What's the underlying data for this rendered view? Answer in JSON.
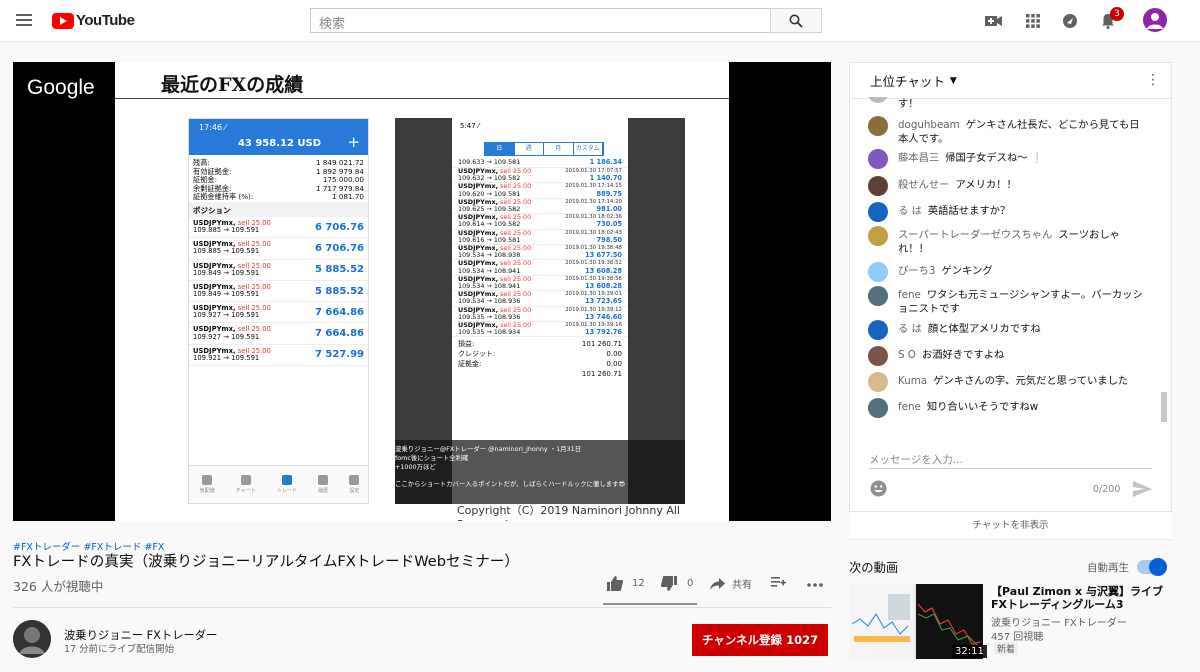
{
  "header": {
    "logo": "YouTube",
    "search_placeholder": "検索",
    "notif_count": "3"
  },
  "video": {
    "google_text": "Google",
    "slide_title": "最近のFXの成績",
    "copyright": "Copyright（C）2019 Naminori Johnny All Reserved",
    "phone1": {
      "time": "17:46 ⁄",
      "balance": "43 958.12 USD",
      "plus": "+",
      "stats": [
        {
          "k": "残高:",
          "v": "1 849 021.72"
        },
        {
          "k": "有効証拠金:",
          "v": "1 892 979.84"
        },
        {
          "k": "証拠金:",
          "v": "175 000.00"
        },
        {
          "k": "余剰証拠金:",
          "v": "1 717 979.84"
        },
        {
          "k": "証拠金維持率 (%):",
          "v": "1 081.70"
        }
      ],
      "positions_title": "ポジション",
      "positions": [
        {
          "sym": "USDJPYmx,",
          "side": "sell 25.00",
          "rate": "109.885 → 109.591",
          "profit": "6 706.76"
        },
        {
          "sym": "USDJPYmx,",
          "side": "sell 25.00",
          "rate": "109.885 → 109.591",
          "profit": "6 706.76"
        },
        {
          "sym": "USDJPYmx,",
          "side": "sell 25.00",
          "rate": "109.849 → 109.591",
          "profit": "5 885.52"
        },
        {
          "sym": "USDJPYmx,",
          "side": "sell 25.00",
          "rate": "109.849 → 109.591",
          "profit": "5 885.52"
        },
        {
          "sym": "USDJPYmx,",
          "side": "sell 25.00",
          "rate": "109.927 → 109.591",
          "profit": "7 664.86"
        },
        {
          "sym": "USDJPYmx,",
          "side": "sell 25.00",
          "rate": "109.927 → 109.591",
          "profit": "7 664.86"
        },
        {
          "sym": "USDJPYmx,",
          "side": "sell 25.00",
          "rate": "109.921 → 109.591",
          "profit": "7 527.99"
        }
      ],
      "nav": [
        "気配値",
        "チャート",
        "トレード",
        "履歴",
        "設定"
      ]
    },
    "phone2": {
      "time": "5:47 ⁄",
      "tabs": [
        "日",
        "週",
        "月",
        "カスタム"
      ],
      "first": {
        "rate": "109.633 → 109.581",
        "profit": "1 186.34"
      },
      "trades": [
        {
          "sym": "USDJPYmx,",
          "side": "sell 25.00",
          "date": "2019.01.30 17:07:57",
          "rate": "109.632 → 109.582",
          "profit": "1 140.70"
        },
        {
          "sym": "USDJPYmx,",
          "side": "sell 25.00",
          "date": "2019.01.30 17:14:15",
          "rate": "109.620 → 109.581",
          "profit": "889.75"
        },
        {
          "sym": "USDJPYmx,",
          "side": "sell 25.00",
          "date": "2019.01.30 17:14:20",
          "rate": "109.625 → 109.582",
          "profit": "981.00"
        },
        {
          "sym": "USDJPYmx,",
          "side": "sell 25.00",
          "date": "2019.01.30 18:02:36",
          "rate": "109.614 → 109.582",
          "profit": "730.05"
        },
        {
          "sym": "USDJPYmx,",
          "side": "sell 25.00",
          "date": "2019.01.30 18:02:43",
          "rate": "109.616 → 109.581",
          "profit": "798.50"
        },
        {
          "sym": "USDJPYmx,",
          "side": "sell 25.00",
          "date": "2019.01.30 19:38:48",
          "rate": "109.534 → 108.938",
          "profit": "13 677.50"
        },
        {
          "sym": "USDJPYmx,",
          "side": "sell 25.00",
          "date": "2019.01.30 19:38:52",
          "rate": "109.534 → 108.941",
          "profit": "13 608.28"
        },
        {
          "sym": "USDJPYmx,",
          "side": "sell 25.00",
          "date": "2019.01.30 19:38:56",
          "rate": "109.534 → 108.941",
          "profit": "13 608.28"
        },
        {
          "sym": "USDJPYmx,",
          "side": "sell 25.00",
          "date": "2019.01.30 19:39:01",
          "rate": "109.534 → 108.936",
          "profit": "13 723.65"
        },
        {
          "sym": "USDJPYmx,",
          "side": "sell 25.00",
          "date": "2019.01.30 19:39:12",
          "rate": "109.535 → 108.936",
          "profit": "13 746.60"
        },
        {
          "sym": "USDJPYmx,",
          "side": "sell 25.00",
          "date": "2019.01.30 19:39:16",
          "rate": "109.535 → 108.934",
          "profit": "13 792.76"
        }
      ],
      "summary": [
        {
          "k": "損益:",
          "v": "101 260.71"
        },
        {
          "k": "クレジット:",
          "v": "0.00"
        },
        {
          "k": "証拠金:",
          "v": "0.00"
        },
        {
          "k": "",
          "v": "101 260.71"
        }
      ],
      "overlay": {
        "line1": "波乗りジョニー@FXトレーダー @naminori_jhonny ・1月31日",
        "line2": "fomc後にショート全利確",
        "line3": "+1000万ほど",
        "line4": "ここからショートカバー入るポイントだが、しばらくハードルックに徹します😎"
      }
    }
  },
  "info": {
    "hashtags": "#FXトレーダー #FXトレード #FX",
    "title": "FXトレードの真実（波乗りジョニーリアルタイムFXトレードWebセミナー）",
    "viewers": "326 人が視聴中",
    "likes": "12",
    "dislikes": "0",
    "share": "共有"
  },
  "channel": {
    "name": "波乗りジョニー FXトレーダー",
    "started": "17 分前にライブ配信開始",
    "subscribe": "チャンネル登録  1027"
  },
  "chat": {
    "header": "上位チャット",
    "messages": [
      {
        "author": "",
        "text": "す！",
        "color": "#bbb"
      },
      {
        "author": "doguhbeam",
        "text": "ゲンキさん社長だ、どこから見ても日本人です。",
        "color": "#8a6d3b"
      },
      {
        "author": "藤本昌三",
        "text": "帰国子女デスね～ ❕",
        "color": "#7e57c2"
      },
      {
        "author": "殺せんせー",
        "text": "アメリカ！！",
        "color": "#5d4037"
      },
      {
        "author": "る は",
        "text": "英語話せますか？",
        "color": "#1565c0"
      },
      {
        "author": "スーパートレーダーゼウスちゃん",
        "text": "スーツおしゃれ！！",
        "color": "#c0a040"
      },
      {
        "author": "ぴーち3",
        "text": "ゲンキング",
        "color": "#90caf9"
      },
      {
        "author": "fene",
        "text": "ワタシも元ミュージシャンすよー。バーカッショニストです",
        "color": "#546e7a"
      },
      {
        "author": "る は",
        "text": "顔と体型アメリカですね",
        "color": "#1565c0"
      },
      {
        "author": "S O",
        "text": "お酒好きですよね",
        "color": "#795548"
      },
      {
        "author": "Kuma",
        "text": "ゲンキさんの字、元気だと思っていました",
        "color": "#d7b98e"
      },
      {
        "author": "fene",
        "text": "知り合いいそうですねw",
        "color": "#546e7a"
      }
    ],
    "input_placeholder": "メッセージを入力...",
    "counter": "0/200",
    "hide": "チャットを非表示"
  },
  "upnext": {
    "label": "次の動画",
    "autoplay": "自動再生",
    "autoplay_on": true,
    "title": "【Paul Zimon x 与沢翼】ライブFXトレーディングルーム3",
    "channel": "波乗りジョニー FXトレーダー",
    "views": "457 回視聴",
    "badge": "新着",
    "duration": "32:11"
  }
}
